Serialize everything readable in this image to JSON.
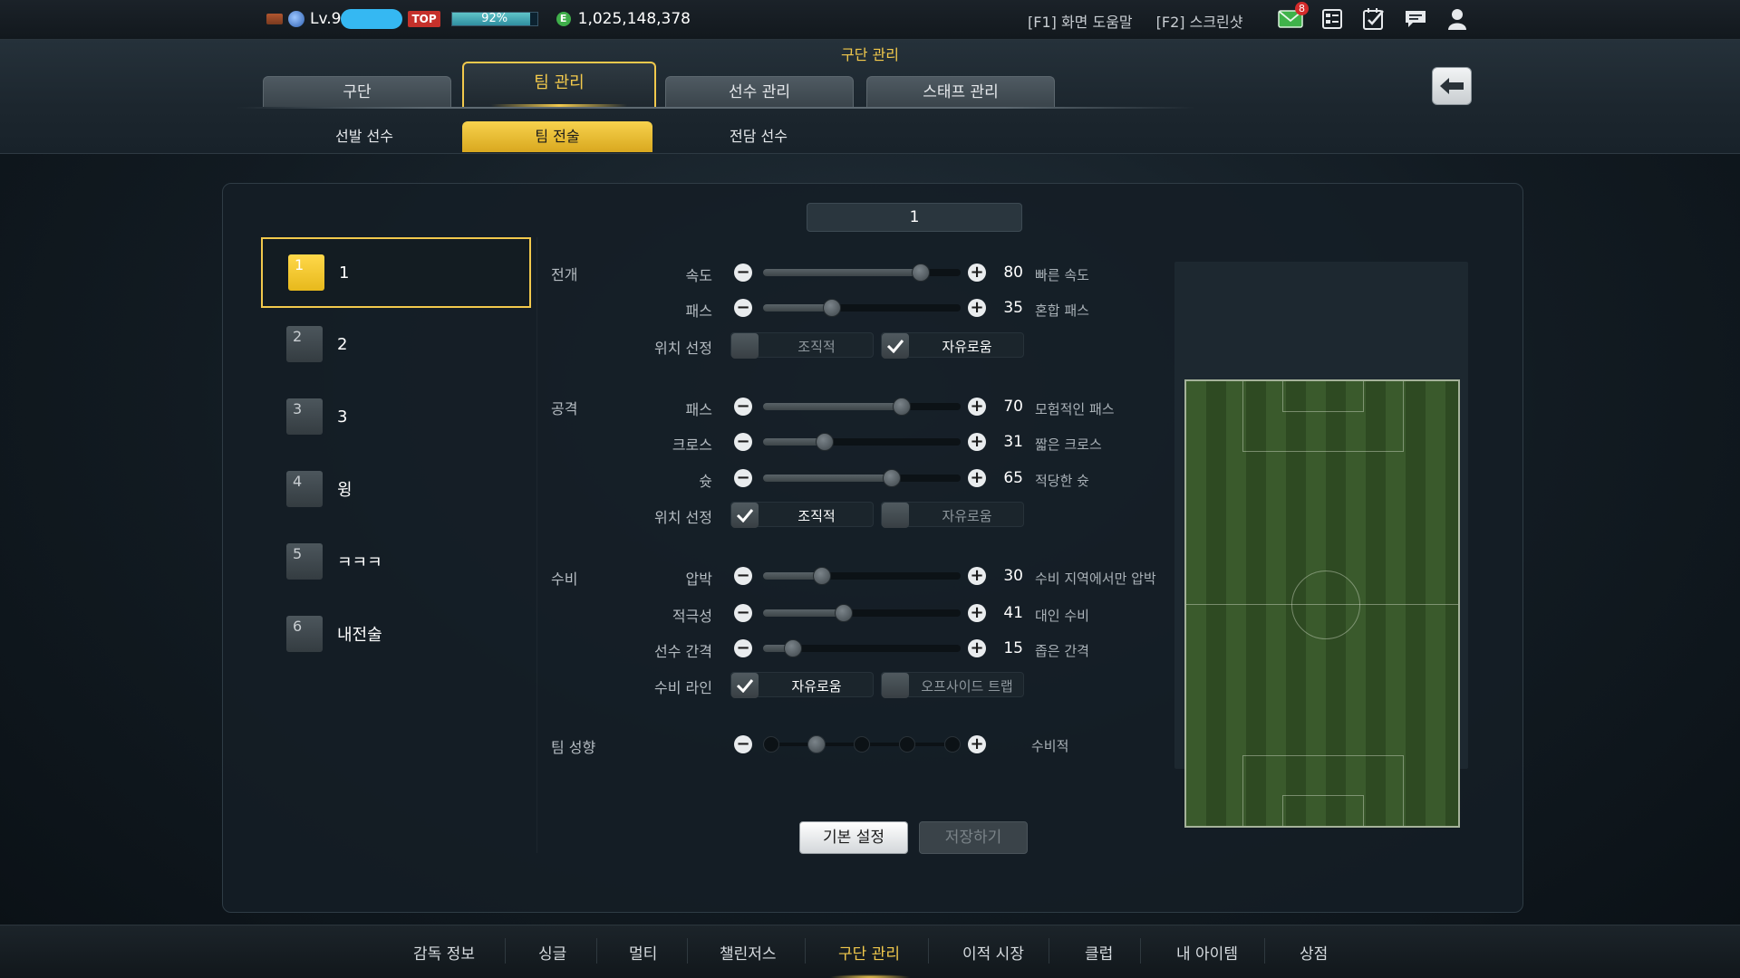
{
  "topbar": {
    "level": "Lv.9",
    "top_badge": "TOP",
    "xp_percent": 92,
    "xp_text": "92%",
    "coin_icon": "E",
    "money": "1,025,148,378",
    "help": "[F1] 화면 도움말",
    "screenshot": "[F2] 스크린샷",
    "mail_count": "8",
    "icons": [
      "mail-icon",
      "list-icon",
      "calendar-check-icon",
      "chat-icon",
      "profile-icon"
    ]
  },
  "header": {
    "title": "구단 관리",
    "tabs": [
      {
        "label": "구단"
      },
      {
        "label": "팀 관리"
      },
      {
        "label": "선수 관리"
      },
      {
        "label": "스태프 관리"
      }
    ],
    "sub_tabs": [
      {
        "label": "선발 선수"
      },
      {
        "label": "팀 전술"
      },
      {
        "label": "전담 선수"
      }
    ]
  },
  "preset_name": "1",
  "presets": [
    {
      "num": "1",
      "label": "1"
    },
    {
      "num": "2",
      "label": "2"
    },
    {
      "num": "3",
      "label": "3"
    },
    {
      "num": "4",
      "label": "윙"
    },
    {
      "num": "5",
      "label": "ㅋㅋㅋ"
    },
    {
      "num": "6",
      "label": "내전술"
    }
  ],
  "tactics": {
    "buildup": {
      "label": "전개",
      "speed": {
        "label": "속도",
        "value": "80",
        "desc": "빠른 속도"
      },
      "passing": {
        "label": "패스",
        "value": "35",
        "desc": "혼합 패스"
      },
      "positioning": {
        "label": "위치 선정",
        "option_a": "조직적",
        "option_b": "자유로움",
        "selected": "option_b"
      }
    },
    "attack": {
      "label": "공격",
      "passing": {
        "label": "패스",
        "value": "70",
        "desc": "모험적인 패스"
      },
      "crossing": {
        "label": "크로스",
        "value": "31",
        "desc": "짧은 크로스"
      },
      "shooting": {
        "label": "슛",
        "value": "65",
        "desc": "적당한 슛"
      },
      "positioning": {
        "label": "위치 선정",
        "option_a": "조직적",
        "option_b": "자유로움",
        "selected": "option_a"
      }
    },
    "defense": {
      "label": "수비",
      "pressure": {
        "label": "압박",
        "value": "30",
        "desc": "수비 지역에서만 압박"
      },
      "aggression": {
        "label": "적극성",
        "value": "41",
        "desc": "대인 수비"
      },
      "width": {
        "label": "선수 간격",
        "value": "15",
        "desc": "좁은 간격"
      },
      "line": {
        "label": "수비 라인",
        "option_a": "자유로움",
        "option_b": "오프사이드 트랩",
        "selected": "option_a"
      }
    },
    "team_style": {
      "label": "팀 성향",
      "level_index": 1,
      "levels": 5,
      "desc": "수비적"
    }
  },
  "buttons": {
    "default": "기본 설정",
    "save": "저장하기"
  },
  "bottom_nav": [
    {
      "label": "감독 정보"
    },
    {
      "label": "싱글"
    },
    {
      "label": "멀티"
    },
    {
      "label": "챌린저스"
    },
    {
      "label": "구단 관리"
    },
    {
      "label": "이적 시장"
    },
    {
      "label": "클럽"
    },
    {
      "label": "내 아이템"
    },
    {
      "label": "상점"
    }
  ],
  "colors": {
    "accent": "#f2c94c",
    "background": "#121b22",
    "pitch": "#3a5a2c"
  }
}
